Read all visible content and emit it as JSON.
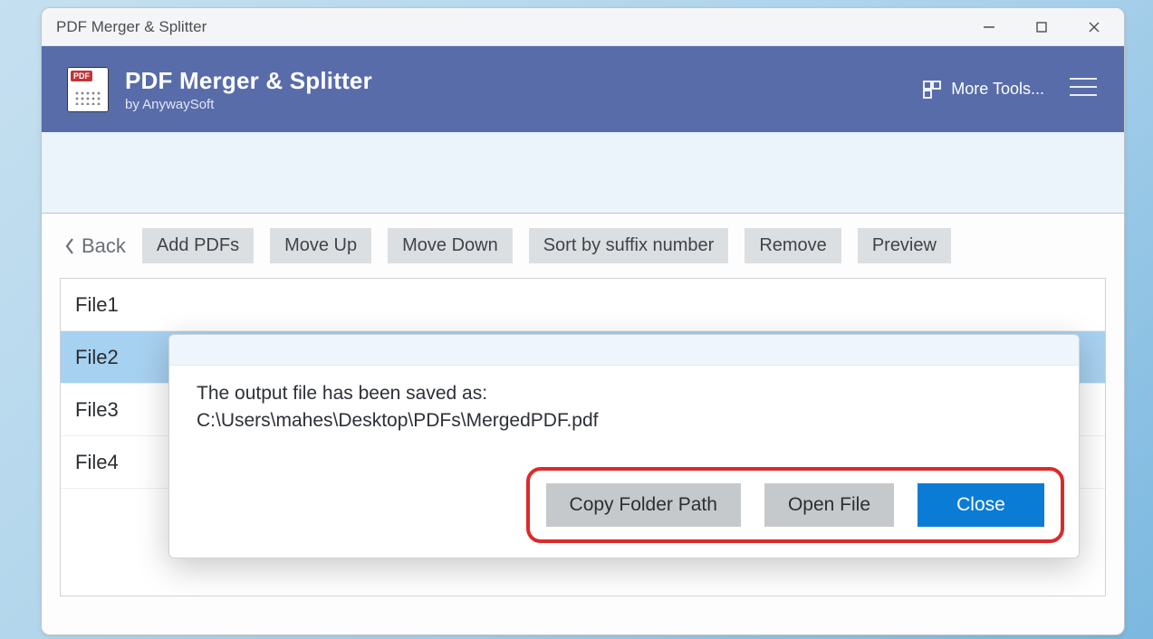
{
  "window": {
    "title": "PDF Merger & Splitter"
  },
  "app": {
    "title": "PDF Merger & Splitter",
    "subtitle": "by AnywaySoft",
    "more_tools_label": "More Tools..."
  },
  "toolbar": {
    "back_label": "Back",
    "buttons": {
      "add": "Add PDFs",
      "up": "Move Up",
      "down": "Move Down",
      "sort": "Sort by suffix number",
      "remove": "Remove",
      "preview": "Preview"
    }
  },
  "files": {
    "items": [
      "File1",
      "File2",
      "File3",
      "File4"
    ],
    "selected_index": 1
  },
  "dialog": {
    "line1": "The output file has been saved as:",
    "line2": "C:\\Users\\mahes\\Desktop\\PDFs\\MergedPDF.pdf",
    "buttons": {
      "copy": "Copy Folder Path",
      "open": "Open File",
      "close": "Close"
    }
  }
}
